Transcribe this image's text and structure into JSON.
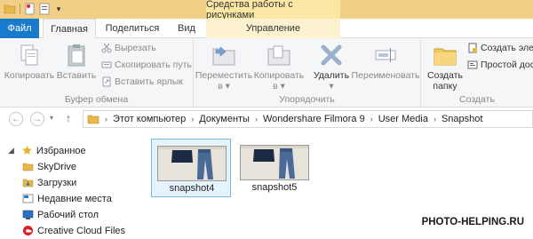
{
  "quick_access": {
    "icons": [
      "folder-icon",
      "new-document-icon",
      "properties-icon",
      "customize-dropdown-icon"
    ]
  },
  "context_tab_title": "Средства работы с рисунками",
  "tabs": {
    "file": "Файл",
    "home": "Главная",
    "share": "Поделиться",
    "view": "Вид",
    "manage": "Управление"
  },
  "ribbon": {
    "clipboard": {
      "label": "Буфер обмена",
      "copy": "Копировать",
      "paste": "Вставить",
      "cut": "Вырезать",
      "copy_path": "Скопировать путь",
      "paste_shortcut": "Вставить ярлык"
    },
    "organize": {
      "label": "Упорядочить",
      "move_to": "Переместить",
      "move_to_arrow": "в ▾",
      "copy_to": "Копировать",
      "copy_to_arrow": "в ▾",
      "delete": "Удалить",
      "delete_arrow": "▾",
      "rename": "Переименовать"
    },
    "new": {
      "label": "Создать",
      "new_folder_line1": "Создать",
      "new_folder_line2": "папку",
      "new_item": "Создать элем",
      "easy_access": "Простой дос"
    }
  },
  "address": {
    "crumbs": [
      "Этот компьютер",
      "Документы",
      "Wondershare Filmora 9",
      "User Media",
      "Snapshot"
    ]
  },
  "nav": {
    "favorites": "Избранное",
    "items": [
      "SkyDrive",
      "Загрузки",
      "Недавние места",
      "Рабочий стол",
      "Creative Cloud Files"
    ]
  },
  "files": [
    {
      "name": "snapshot4",
      "selected": true
    },
    {
      "name": "snapshot5",
      "selected": false
    }
  ],
  "watermark": "PHOTO-HELPING.RU",
  "colors": {
    "title_bar": "#f2cf86",
    "context_tab": "#fae7a4",
    "file_tab": "#1979ca",
    "selection": "#e5f3fb",
    "selection_border": "#7ab8e6"
  }
}
